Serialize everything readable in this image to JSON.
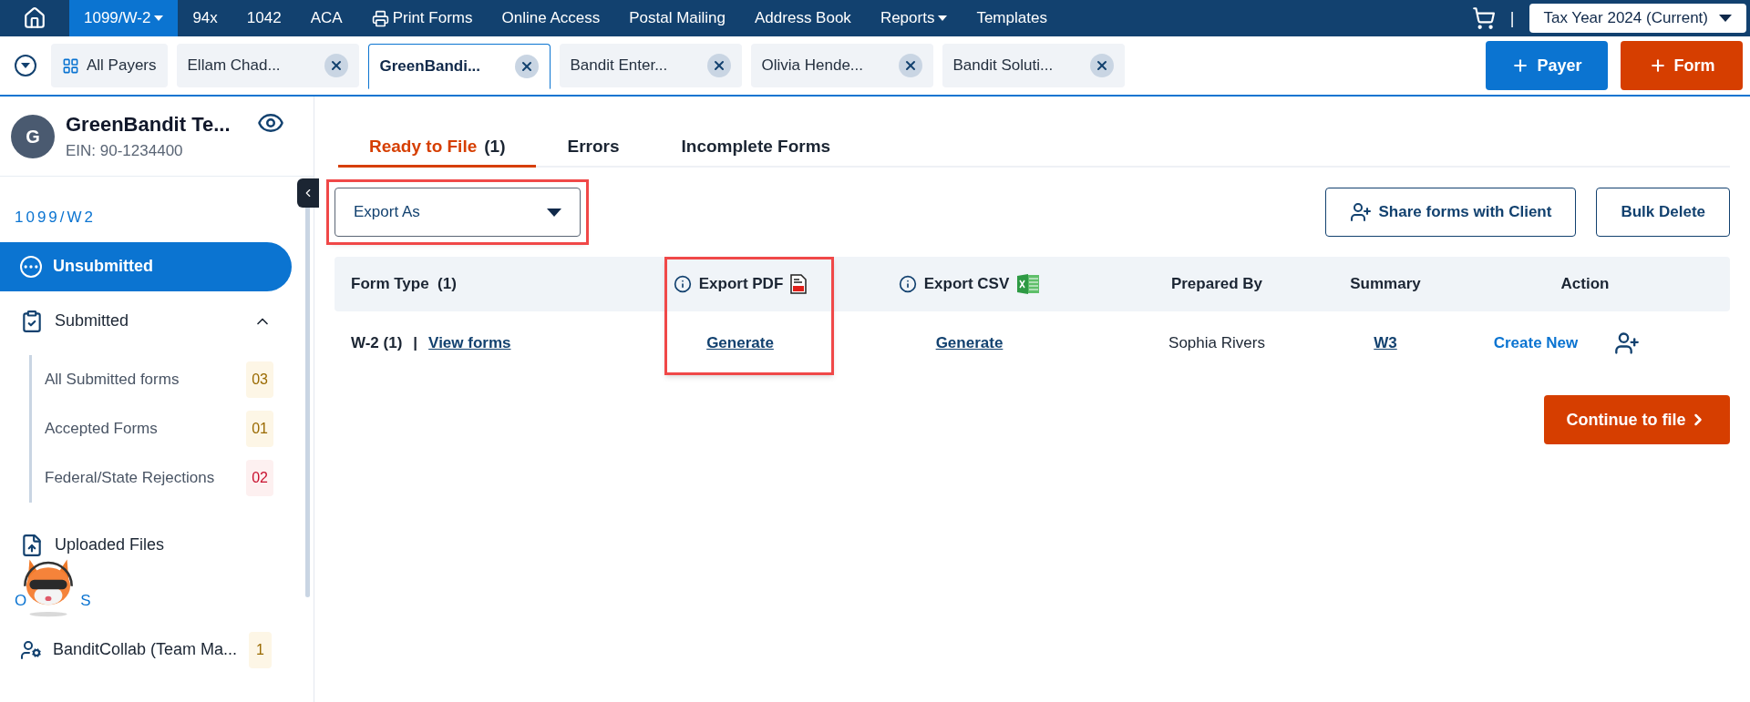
{
  "nav": {
    "items": [
      {
        "label": "1099/W-2",
        "kind": "menu",
        "selected": true
      },
      {
        "label": "94x",
        "kind": "link",
        "selected": false
      },
      {
        "label": "1042",
        "kind": "link",
        "selected": false
      },
      {
        "label": "ACA",
        "kind": "link",
        "selected": false
      },
      {
        "label": "Print Forms",
        "kind": "print",
        "selected": false
      },
      {
        "label": "Online Access",
        "kind": "link",
        "selected": false
      },
      {
        "label": "Postal Mailing",
        "kind": "link",
        "selected": false
      },
      {
        "label": "Address Book",
        "kind": "link",
        "selected": false
      },
      {
        "label": "Reports",
        "kind": "menu",
        "selected": false
      },
      {
        "label": "Templates",
        "kind": "link",
        "selected": false
      }
    ],
    "separator": "|",
    "tax_year": "Tax Year 2024 (Current)"
  },
  "payer_tabs": [
    {
      "label": "All Payers",
      "kind": "all",
      "selected": false
    },
    {
      "label": "Ellam Chad...",
      "kind": "payer",
      "selected": false
    },
    {
      "label": "GreenBandi...",
      "kind": "payer",
      "selected": true
    },
    {
      "label": "Bandit Enter...",
      "kind": "payer",
      "selected": false
    },
    {
      "label": "Olivia Hende...",
      "kind": "payer",
      "selected": false
    },
    {
      "label": "Bandit Soluti...",
      "kind": "payer",
      "selected": false
    }
  ],
  "header_buttons": [
    {
      "label": "Payer",
      "kind": "blue"
    },
    {
      "label": "Form",
      "kind": "orange"
    }
  ],
  "sidebar": {
    "avatar": "G",
    "payer_name": "GreenBandit Te...",
    "ein": "EIN: 90-1234400",
    "section": "1099/W2",
    "items": [
      {
        "label": "Unsubmitted",
        "kind": "dots",
        "selected": true
      },
      {
        "label": "Submitted",
        "kind": "clipboard",
        "selected": false,
        "expanded": true,
        "children": [
          {
            "label": "All Submitted forms",
            "count": "03",
            "color": "#9a6a00"
          },
          {
            "label": "Accepted Forms",
            "count": "01",
            "color": "#9a6a00"
          },
          {
            "label": "Federal/State Rejections",
            "count": "02",
            "color": "#c8102e"
          }
        ]
      },
      {
        "label": "Uploaded Files",
        "kind": "upload",
        "selected": false
      }
    ],
    "others_label_parts": [
      "O",
      "S"
    ],
    "others": [
      {
        "label": "BanditCollab (Team Ma...",
        "count": "1"
      }
    ]
  },
  "status_tabs": [
    {
      "label": "Ready to File",
      "count": "(1)",
      "selected": true
    },
    {
      "label": "Errors",
      "selected": false
    },
    {
      "label": "Incomplete Forms",
      "selected": false
    }
  ],
  "export_dropdown": {
    "label": "Export As",
    "highlighted": true
  },
  "actions": [
    {
      "label": "Share forms with Client",
      "kind": "share"
    },
    {
      "label": "Bulk Delete",
      "kind": "plain"
    }
  ],
  "table": {
    "columns": [
      {
        "label": "Form Type  (1)",
        "kind": "plain",
        "highlighted": false
      },
      {
        "label": "Export PDF",
        "kind": "pdf",
        "highlighted": true
      },
      {
        "label": "Export CSV",
        "kind": "csv",
        "highlighted": false
      },
      {
        "label": "Prepared By",
        "kind": "plain",
        "highlighted": false
      },
      {
        "label": "Summary",
        "kind": "plain",
        "highlighted": false
      },
      {
        "label": "Action",
        "kind": "plain",
        "highlighted": false
      }
    ],
    "rows": [
      {
        "form_type": "W-2 (1)",
        "separator": "|",
        "view_link": "View forms",
        "export_pdf": "Generate",
        "export_csv": "Generate",
        "prepared_by": "Sophia Rivers",
        "summary": "W3",
        "action": "Create New"
      }
    ]
  },
  "continue_button": "Continue to file"
}
